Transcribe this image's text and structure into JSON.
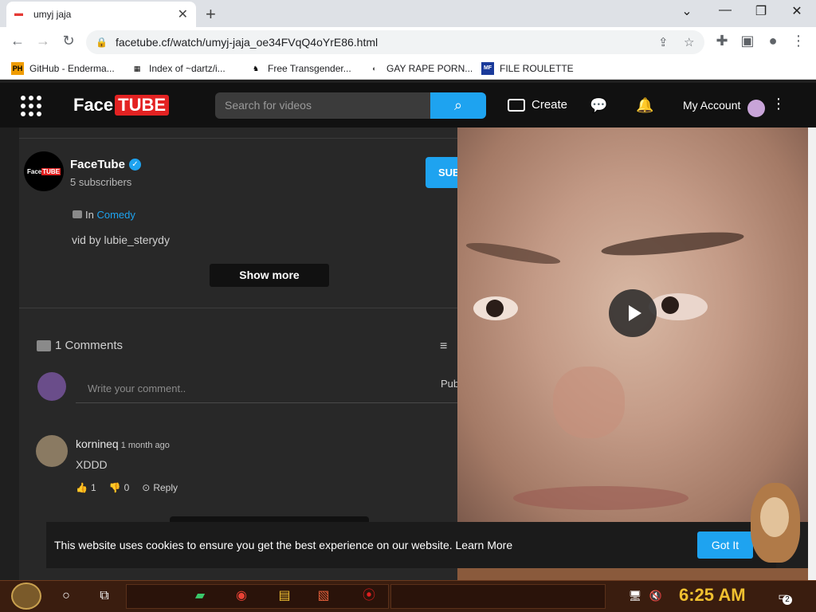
{
  "browser": {
    "tab_title": "umyj jaja",
    "url": "facetube.cf/watch/umyj-jaja_oe34FVqQ4oYrE86.html",
    "bookmarks": [
      {
        "icon": "PH",
        "label": "GitHub - Enderma..."
      },
      {
        "icon": "▦",
        "label": "Index of ~dartz/i..."
      },
      {
        "icon": "♞",
        "label": "Free Transgender..."
      },
      {
        "icon": "◐",
        "label": "GAY RAPE PORN..."
      },
      {
        "icon": "MF",
        "label": "FILE ROULETTE"
      }
    ]
  },
  "site": {
    "logo_face": "Face",
    "logo_tube": "TUBE",
    "search_placeholder": "Search for videos",
    "create_label": "Create",
    "account_label": "My Account"
  },
  "channel": {
    "name": "FaceTube",
    "subscribers": "5 subscribers",
    "subscribe_label": "SUB",
    "avatar_face": "Face",
    "avatar_tube": "TUBE"
  },
  "video_info": {
    "category_prefix": "In",
    "category": "Comedy",
    "description": "vid by lubie_sterydy",
    "show_more": "Show more"
  },
  "comments": {
    "title": "1 Comments",
    "input_placeholder": "Write your comment..",
    "publish_label": "Pub",
    "items": [
      {
        "user": "kornineq",
        "time": "1 month ago",
        "text": "XDDD",
        "likes": "1",
        "dislikes": "0",
        "reply": "Reply"
      }
    ]
  },
  "cookie": {
    "text": "This website uses cookies to ensure you get the best experience on our website. Learn More",
    "button": "Got It"
  },
  "taskbar": {
    "time": "6:25 AM",
    "notification_count": "2"
  },
  "colors": {
    "accent": "#1ea3f0",
    "brand_red": "#e32222",
    "page_bg": "#1f1f1f"
  }
}
